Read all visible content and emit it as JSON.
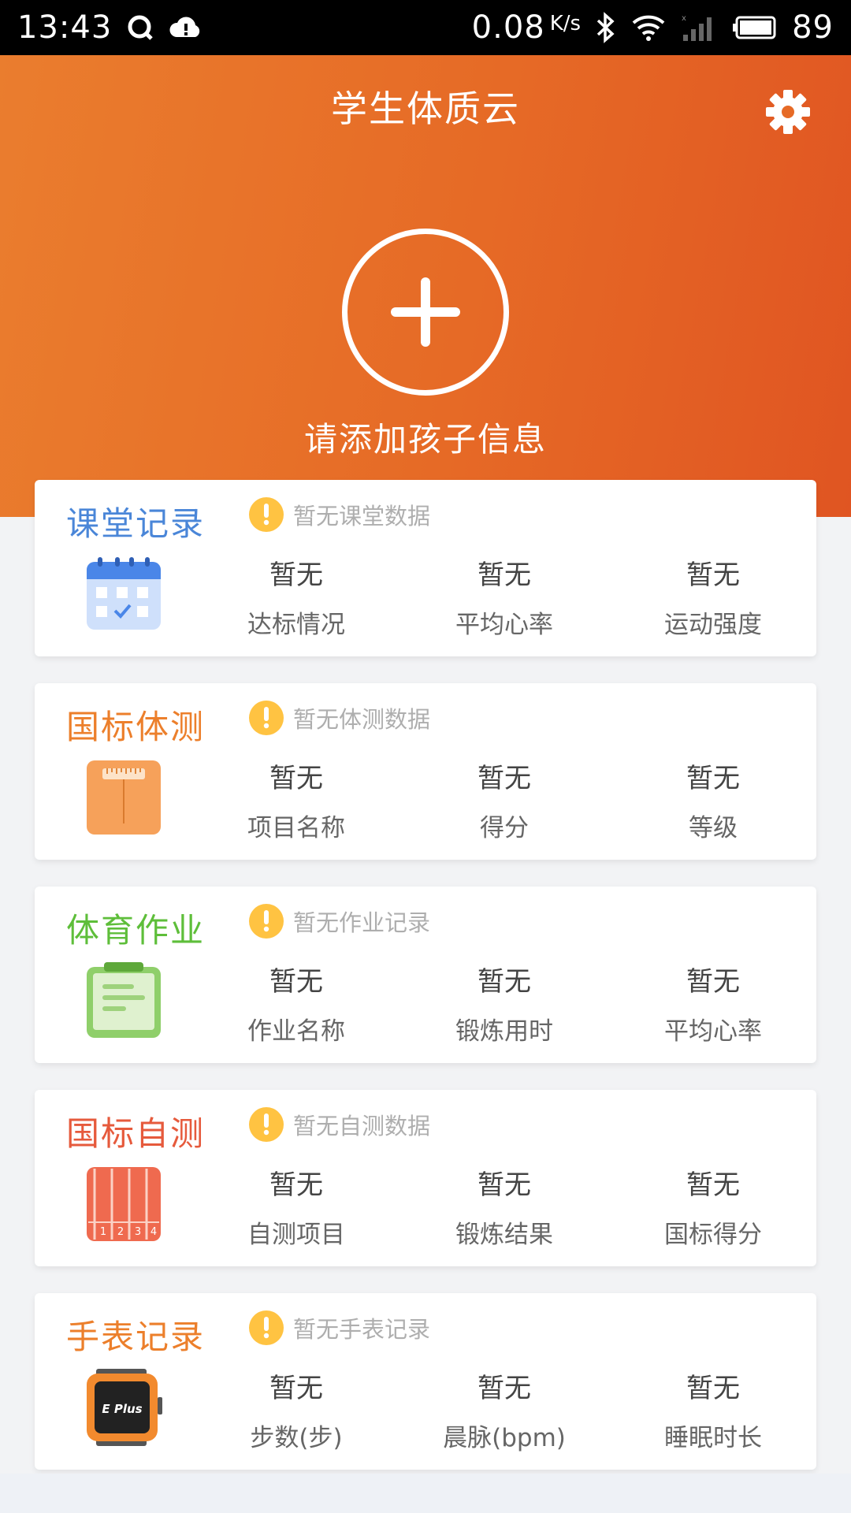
{
  "status_bar": {
    "time": "13:43",
    "net_speed": "0.08",
    "net_speed_unit": "K/s",
    "battery": "89"
  },
  "header": {
    "title": "学生体质云",
    "add_child_label": "请添加孩子信息"
  },
  "colors": {
    "header_gradient": [
      "#ea7d2e",
      "#e05522"
    ],
    "title_classroom": "#4a86d8",
    "title_national_test": "#ec7f2b",
    "title_pe_homework": "#5ebe3a",
    "title_self_test": "#e65a3c",
    "title_watch": "#ec7f2b",
    "warning": "#ffc342"
  },
  "cards": [
    {
      "title": "课堂记录",
      "hint": "暂无课堂数据",
      "icon": "calendar-icon",
      "metrics": [
        {
          "value": "暂无",
          "label": "达标情况"
        },
        {
          "value": "暂无",
          "label": "平均心率"
        },
        {
          "value": "暂无",
          "label": "运动强度"
        }
      ]
    },
    {
      "title": "国标体测",
      "hint": "暂无体测数据",
      "icon": "ruler-box-icon",
      "metrics": [
        {
          "value": "暂无",
          "label": "项目名称"
        },
        {
          "value": "暂无",
          "label": "得分"
        },
        {
          "value": "暂无",
          "label": "等级"
        }
      ]
    },
    {
      "title": "体育作业",
      "hint": "暂无作业记录",
      "icon": "clipboard-icon",
      "metrics": [
        {
          "value": "暂无",
          "label": "作业名称"
        },
        {
          "value": "暂无",
          "label": "锻炼用时"
        },
        {
          "value": "暂无",
          "label": "平均心率"
        }
      ]
    },
    {
      "title": "国标自测",
      "hint": "暂无自测数据",
      "icon": "running-track-icon",
      "lane_numbers": [
        "1",
        "2",
        "3",
        "4"
      ],
      "metrics": [
        {
          "value": "暂无",
          "label": "自测项目"
        },
        {
          "value": "暂无",
          "label": "锻炼结果"
        },
        {
          "value": "暂无",
          "label": "国标得分"
        }
      ]
    },
    {
      "title": "手表记录",
      "hint": "暂无手表记录",
      "icon": "smartwatch-icon",
      "watch_brand": "E Plus",
      "metrics": [
        {
          "value": "暂无",
          "label": "步数(步)"
        },
        {
          "value": "暂无",
          "label": "晨脉(bpm)"
        },
        {
          "value": "暂无",
          "label": "睡眠时长"
        }
      ]
    }
  ]
}
